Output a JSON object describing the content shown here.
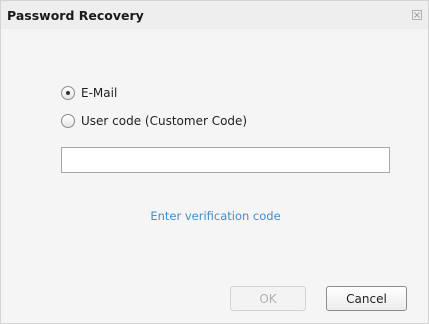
{
  "dialog": {
    "title": "Password Recovery",
    "close_icon": "close-icon"
  },
  "options": [
    {
      "label": "E-Mail",
      "checked": true
    },
    {
      "label": "User code (Customer Code)",
      "checked": false
    }
  ],
  "input": {
    "value": "",
    "placeholder": ""
  },
  "verification_link": "Enter verification code",
  "buttons": {
    "ok_label": "OK",
    "ok_enabled": false,
    "cancel_label": "Cancel"
  },
  "colors": {
    "link": "#3f8fca",
    "disabled_text": "#b2b2b2"
  }
}
